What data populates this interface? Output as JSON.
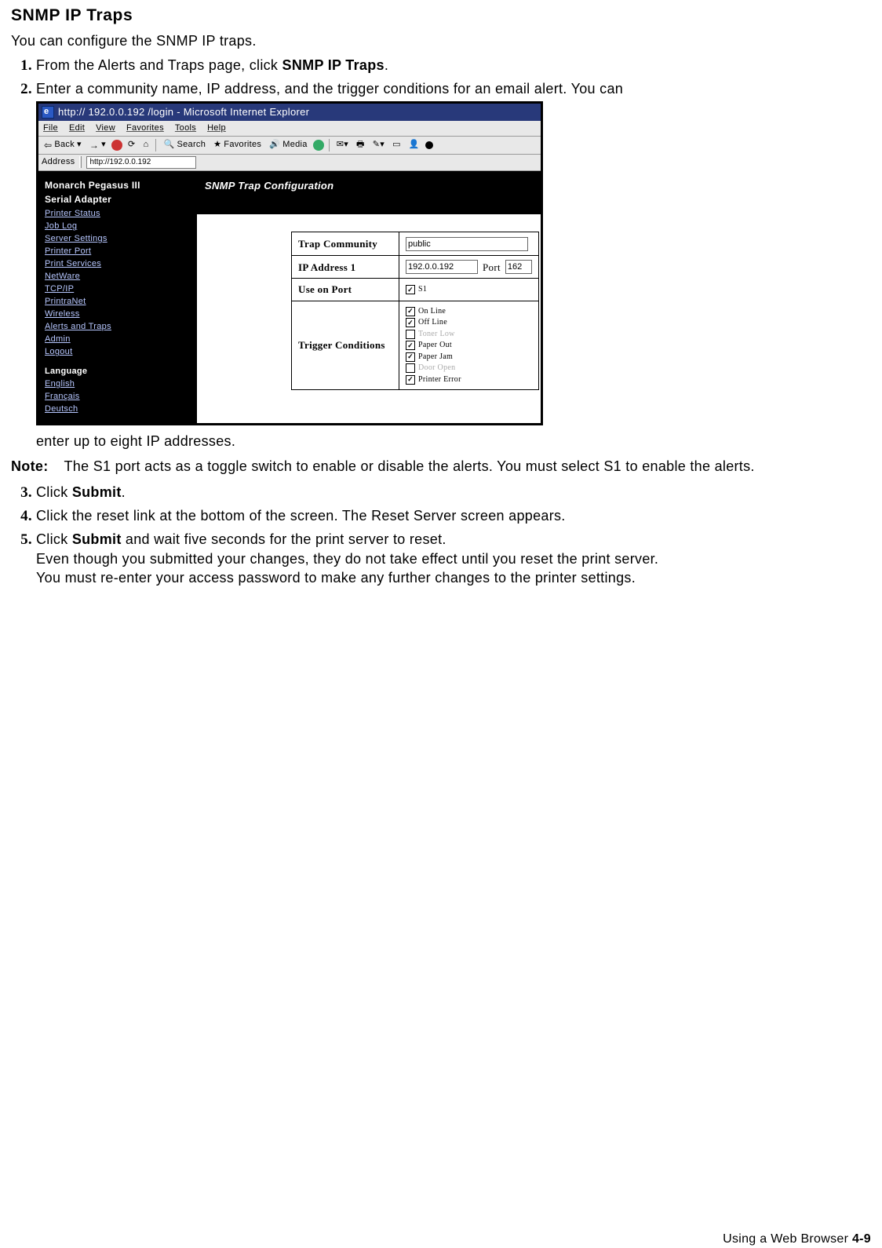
{
  "heading": "SNMP IP Traps",
  "intro": "You can configure the SNMP IP traps.",
  "steps": {
    "s1a": "From the Alerts and Traps page, click ",
    "s1b": "SNMP IP Traps",
    "s1c": ".",
    "s2": "Enter a community name, IP address, and the trigger conditions for an email alert.  You can",
    "s2_cont": "enter up to eight IP addresses.",
    "s3a": "Click ",
    "s3b": "Submit",
    "s3c": ".",
    "s4": "Click the reset link at the bottom of the screen.  The Reset Server screen appears.",
    "s5a": "Click ",
    "s5b": "Submit",
    "s5c": " and wait five seconds for the print server to reset.",
    "s5d": "Even though you submitted your changes, they do not take effect until you reset the print server.",
    "s5e": "You must re-enter your access password to make any further changes to the printer settings."
  },
  "note": {
    "label": "Note:",
    "text": "The S1 port acts as a toggle switch to enable or disable the alerts. You must select S1 to enable the alerts."
  },
  "ie": {
    "title": "http:// 192.0.0.192  /login - Microsoft Internet Explorer",
    "menu": [
      "File",
      "Edit",
      "View",
      "Favorites",
      "Tools",
      "Help"
    ],
    "toolbar": {
      "back": "Back",
      "search": "Search",
      "favorites": "Favorites",
      "media": "Media"
    },
    "address_label": "Address",
    "address_value": "http://192.0.0.192",
    "sidebar": {
      "hdr1": "Monarch Pegasus III",
      "hdr2": "Serial Adapter",
      "links": [
        "Printer Status",
        "Job Log",
        "Server Settings",
        "Printer Port",
        "Print Services",
        "NetWare",
        "TCP/IP",
        "PrintraNet",
        "Wireless",
        "Alerts and Traps",
        "Admin",
        "Logout"
      ],
      "language_label": "Language",
      "langs": [
        "English",
        "Français",
        "Deutsch"
      ]
    },
    "panel_title": "SNMP Trap Configuration",
    "form": {
      "trap_community_label": "Trap Community",
      "trap_community_value": "public",
      "ip1_label": "IP Address 1",
      "ip1_value": "192.0.0.192",
      "port_label": "Port",
      "port_value": "162",
      "use_on_port_label": "Use on Port",
      "use_on_port_opt": "S1",
      "trigger_label": "Trigger Conditions",
      "triggers": [
        {
          "label": "On Line",
          "checked": true,
          "muted": false
        },
        {
          "label": "Off Line",
          "checked": true,
          "muted": false
        },
        {
          "label": "Toner Low",
          "checked": false,
          "muted": true
        },
        {
          "label": "Paper Out",
          "checked": true,
          "muted": false
        },
        {
          "label": "Paper Jam",
          "checked": true,
          "muted": false
        },
        {
          "label": "Door Open",
          "checked": false,
          "muted": true
        },
        {
          "label": "Printer Error",
          "checked": true,
          "muted": false
        }
      ]
    }
  },
  "footer": {
    "text": "Using a Web Browser  ",
    "page": "4-9"
  }
}
